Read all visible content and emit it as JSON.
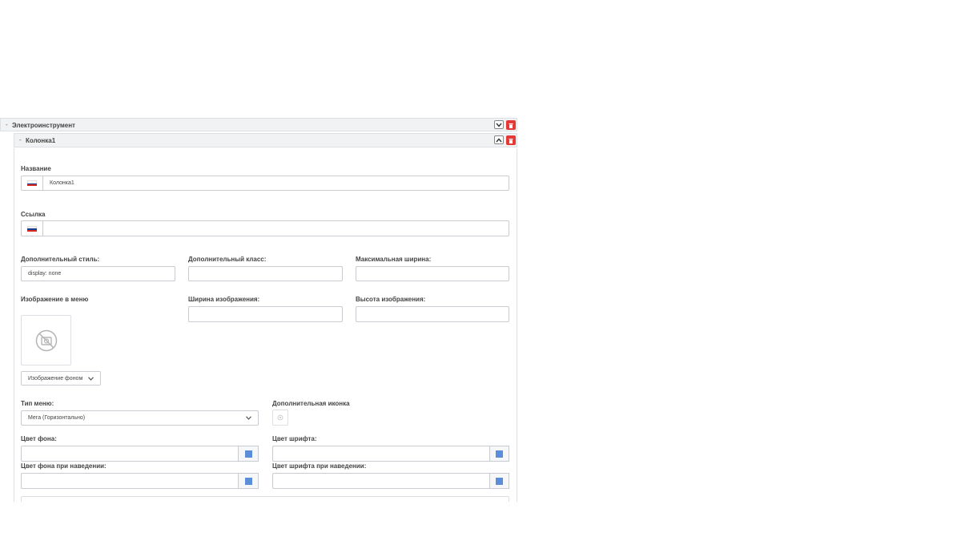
{
  "outer_bar": {
    "dash": "-",
    "title": "Электроинструмент"
  },
  "inner_bar": {
    "dash": "-",
    "title": "Колонка1"
  },
  "form": {
    "name_label": "Название",
    "name_value": "Колонка1",
    "link_label": "Ссылка",
    "link_value": "",
    "extra_style_label": "Дополнительный стиль:",
    "extra_style_value": "display: none",
    "extra_class_label": "Дополнительный класс:",
    "extra_class_value": "",
    "max_width_label": "Максимальная ширина:",
    "max_width_value": "",
    "menu_image_label": "Изображение в меню",
    "image_width_label": "Ширина изображения:",
    "image_width_value": "",
    "image_height_label": "Высота изображения:",
    "image_height_value": "",
    "bg_image_select": "Изображение фоном",
    "menu_type_label": "Тип меню:",
    "menu_type_value": "Мега (Горизонтально)",
    "extra_icon_label": "Дополнительная иконка",
    "bg_color_label": "Цвет фона:",
    "font_color_label": "Цвет шрифта:",
    "bg_hover_label": "Цвет фона при наведении:",
    "font_hover_label": "Цвет шрифта при наведении:"
  },
  "icons": {
    "collapse": "chevron-down-icon",
    "expand": "chevron-up-icon",
    "delete": "trash-icon",
    "no_image": "no-image-icon",
    "flag": "ru-flag-icon",
    "color_swatch": "color-swatch-icon"
  },
  "colors": {
    "delete_red": "#e53935",
    "swatch_blue": "#5b8dd9",
    "flag_white": "#ffffff",
    "flag_blue": "#1c3f94",
    "flag_red": "#d52b1e"
  }
}
